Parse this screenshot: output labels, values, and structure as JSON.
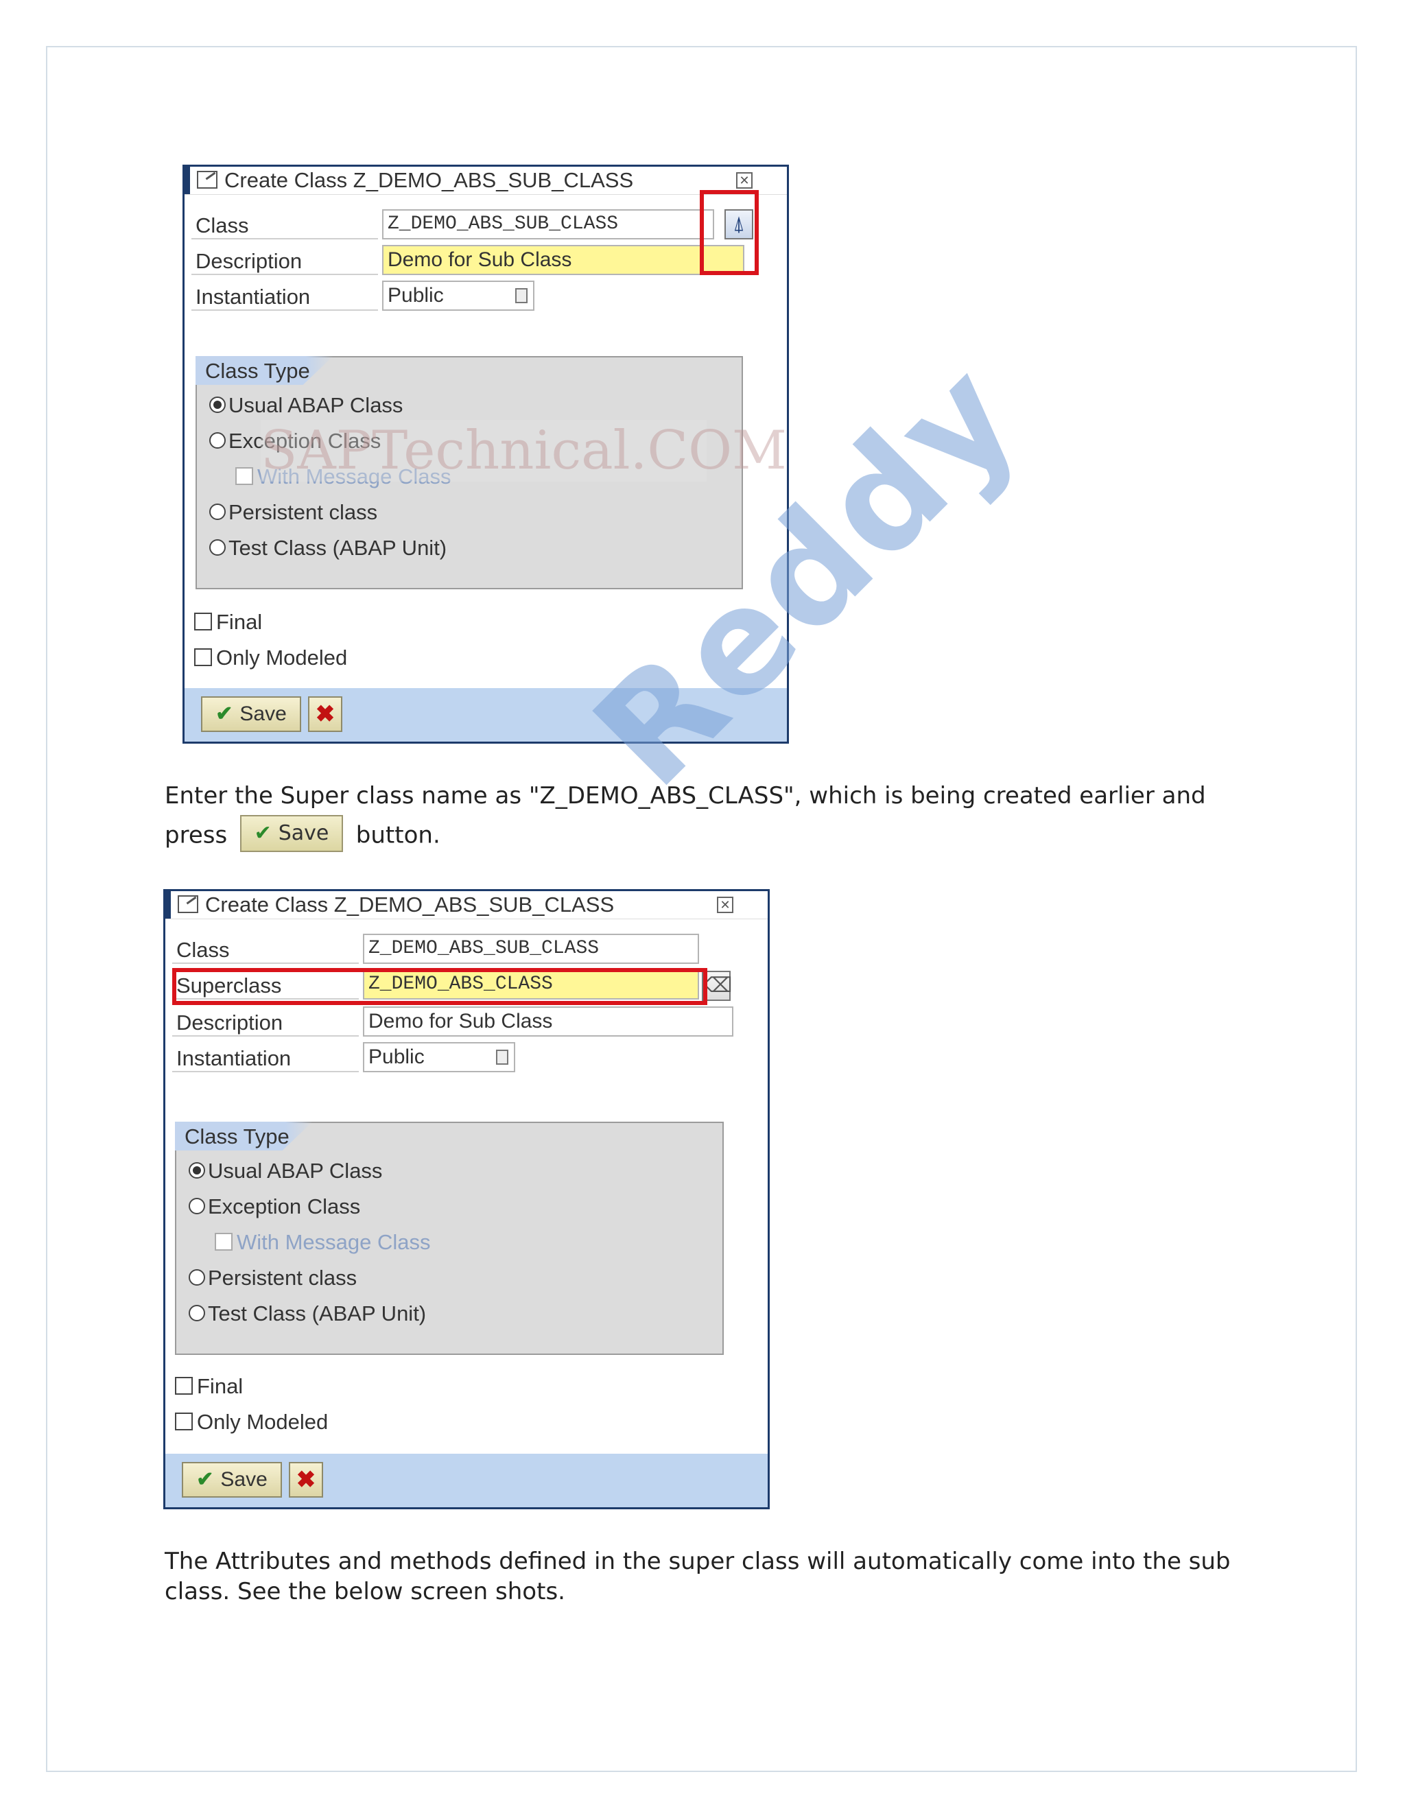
{
  "watermark": "Reddy",
  "stamp": "SAPTechnical.COM",
  "dialog1": {
    "title": "Create Class Z_DEMO_ABS_SUB_CLASS",
    "fields": {
      "class_label": "Class",
      "class_value": "Z_DEMO_ABS_SUB_CLASS",
      "description_label": "Description",
      "description_value": "Demo for Sub Class",
      "instantiation_label": "Instantiation",
      "instantiation_value": "Public"
    },
    "class_type": {
      "title": "Class Type",
      "options": [
        "Usual ABAP Class",
        "Exception Class",
        "With Message Class",
        "Persistent class",
        "Test Class (ABAP Unit)"
      ],
      "selected": "Usual ABAP Class"
    },
    "final_label": "Final",
    "only_modeled_label": "Only Modeled",
    "save_label": "Save",
    "cancel_icon": "✖"
  },
  "instruction": {
    "line1": "Enter the Super class name as \"Z_DEMO_ABS_CLASS\", which is being created earlier and",
    "press": "press",
    "save_label": "Save",
    "after": "button."
  },
  "dialog2": {
    "title": "Create Class Z_DEMO_ABS_SUB_CLASS",
    "fields": {
      "class_label": "Class",
      "class_value": "Z_DEMO_ABS_SUB_CLASS",
      "superclass_label": "Superclass",
      "superclass_value": "Z_DEMO_ABS_CLASS",
      "description_label": "Description",
      "description_value": "Demo for Sub Class",
      "instantiation_label": "Instantiation",
      "instantiation_value": "Public"
    },
    "class_type": {
      "title": "Class Type",
      "options": [
        "Usual ABAP Class",
        "Exception Class",
        "With Message Class",
        "Persistent class",
        "Test Class (ABAP Unit)"
      ],
      "selected": "Usual ABAP Class"
    },
    "final_label": "Final",
    "only_modeled_label": "Only Modeled",
    "save_label": "Save",
    "cancel_icon": "✖"
  },
  "closing": "The Attributes and methods defined in the super class will automatically come into the sub class. See the below screen shots.",
  "colors": {
    "highlight_red": "#d9141b",
    "field_yellow": "#fff797",
    "footer_blue": "#bfd5f0",
    "dialog_border": "#1d3b6b"
  }
}
